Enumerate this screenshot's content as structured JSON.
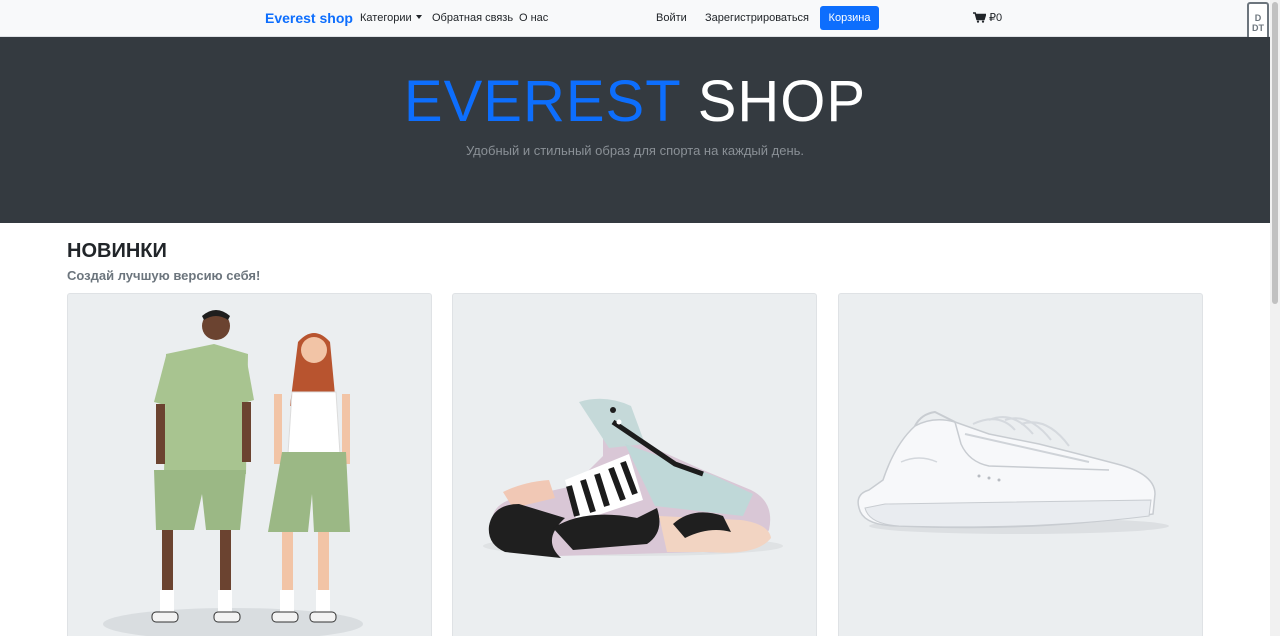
{
  "navbar": {
    "brand": "Everest shop",
    "links": [
      {
        "label": "Категории",
        "dropdown": true
      },
      {
        "label": "Обратная связь"
      },
      {
        "label": "О нас"
      }
    ],
    "login": "Войти",
    "register": "Зарегистрироваться",
    "cart_button": "Корзина",
    "cart_icon": "shopping-cart-icon",
    "cart_total": "₽0"
  },
  "side_badge": {
    "line1": "D",
    "line2": "DT"
  },
  "hero": {
    "title_word1": "EVEREST",
    "title_word2": "SHOP",
    "subtitle": "Удобный и стильный образ для спорта на каждый день."
  },
  "section": {
    "title": "НОВИНКИ",
    "subtitle": "Создай лучшую версию себя!"
  },
  "products": [
    {
      "image": "sage-green-tshirt-and-shorts-on-two-models"
    },
    {
      "image": "lilac-mint-black-chunky-sneaker"
    },
    {
      "image": "white-leather-low-sneaker"
    }
  ],
  "colors": {
    "accent": "#0d6efd",
    "hero_bg": "#343a40",
    "card_bg": "#ebeef0",
    "navbar_bg": "#f8f9fa"
  }
}
